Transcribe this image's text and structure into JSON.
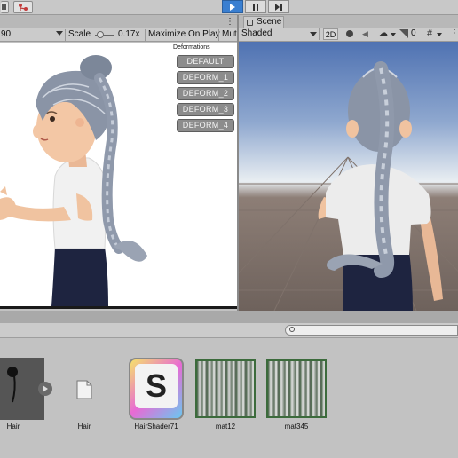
{
  "toolbar": {
    "icons": [
      "layers-icon",
      "git-icon"
    ],
    "play_controls": [
      "play-icon",
      "pause-icon",
      "step-icon"
    ],
    "more_icon": "kebab-menu-icon"
  },
  "game": {
    "resolution_value": "90",
    "scale_label": "Scale",
    "scale_value": "0.17x",
    "maximize_label": "Maximize On Play",
    "mute_label": "Mut"
  },
  "deformations": {
    "title": "Deformations",
    "buttons": [
      "DEFAULT",
      "DEFORM_1",
      "DEFORM_2",
      "DEFORM_3",
      "DEFORM_4"
    ]
  },
  "scene": {
    "tab_label": "Scene",
    "shading_mode": "Shaded",
    "mode_2d": "2D",
    "gizmo_count": "0"
  },
  "project": {
    "search_placeholder": "",
    "assets": [
      {
        "name": "Hair",
        "kind": "model"
      },
      {
        "name": "Hair",
        "kind": "file"
      },
      {
        "name": "HairShader71",
        "kind": "shader"
      },
      {
        "name": "mat12",
        "kind": "material"
      },
      {
        "name": "mat345",
        "kind": "material"
      }
    ]
  },
  "colors": {
    "play_active": "#3a7fd1",
    "shader_icon_gradient": [
      "#f5e26b",
      "#e86ad4",
      "#6ac8f0"
    ]
  }
}
